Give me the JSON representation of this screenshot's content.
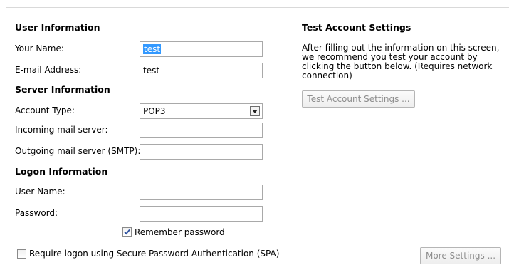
{
  "user_info": {
    "heading": "User Information",
    "name_label": "Your Name:",
    "name_value": "test",
    "email_label": "E-mail Address:",
    "email_value": "test"
  },
  "server_info": {
    "heading": "Server Information",
    "account_type_label": "Account Type:",
    "account_type_value": "POP3",
    "incoming_label": "Incoming mail server:",
    "incoming_value": "",
    "outgoing_label": "Outgoing mail server (SMTP):",
    "outgoing_value": ""
  },
  "logon_info": {
    "heading": "Logon Information",
    "username_label": "User Name:",
    "username_value": "",
    "password_label": "Password:",
    "password_value": "",
    "remember_label": "Remember password",
    "remember_checked": true,
    "spa_label": "Require logon using Secure Password Authentication (SPA)",
    "spa_checked": false
  },
  "test_settings": {
    "heading": "Test Account Settings",
    "description": "After filling out the information on this screen, we recommend you test your account by clicking the button below. (Requires network connection)",
    "button_label": "Test Account Settings ..."
  },
  "more_settings_label": "More Settings ...",
  "icons": {
    "dropdown": "chevron-down-icon",
    "check": "checkmark-icon"
  }
}
